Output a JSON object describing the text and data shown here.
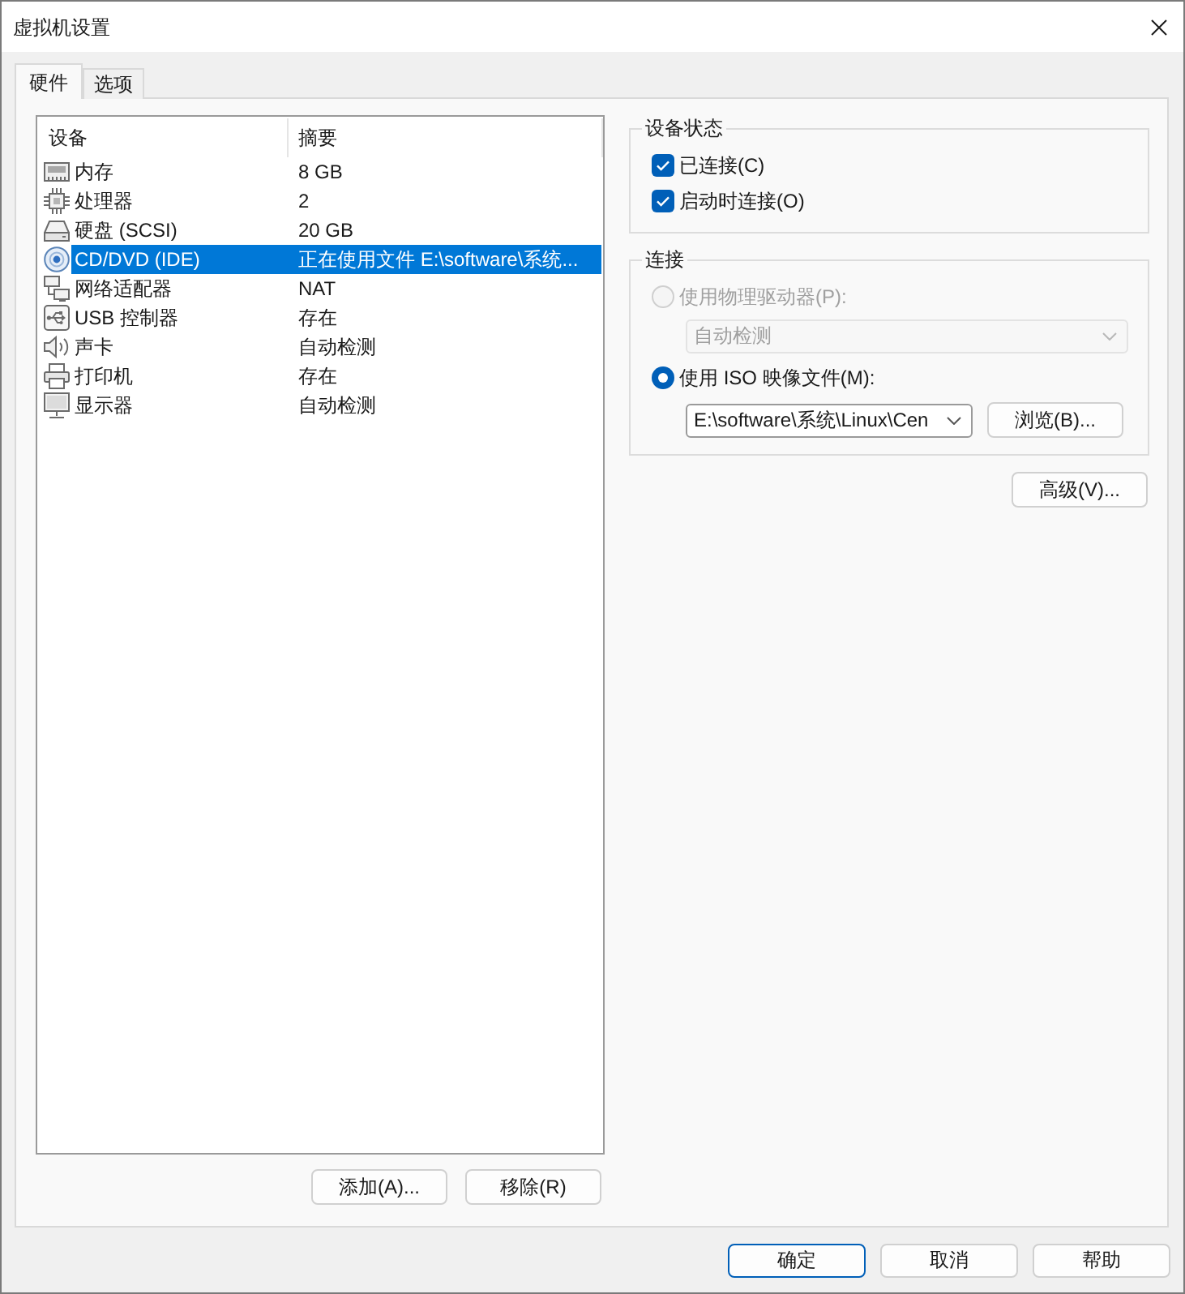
{
  "window": {
    "title": "虚拟机设置"
  },
  "tabs": [
    {
      "label": "硬件",
      "selected": true
    },
    {
      "label": "选项",
      "selected": false
    }
  ],
  "device_list": {
    "columns": [
      "设备",
      "摘要"
    ],
    "rows": [
      {
        "kind": "memory",
        "device": "内存",
        "summary": "8 GB",
        "selected": false
      },
      {
        "kind": "processor",
        "device": "处理器",
        "summary": "2",
        "selected": false
      },
      {
        "kind": "hard_disk",
        "device": "硬盘 (SCSI)",
        "summary": "20 GB",
        "selected": false
      },
      {
        "kind": "cd_dvd",
        "device": "CD/DVD (IDE)",
        "summary": "正在使用文件 E:\\software\\系统...",
        "selected": true
      },
      {
        "kind": "network",
        "device": "网络适配器",
        "summary": "NAT",
        "selected": false
      },
      {
        "kind": "usb",
        "device": "USB 控制器",
        "summary": "存在",
        "selected": false
      },
      {
        "kind": "sound",
        "device": "声卡",
        "summary": "自动检测",
        "selected": false
      },
      {
        "kind": "printer",
        "device": "打印机",
        "summary": "存在",
        "selected": false
      },
      {
        "kind": "display",
        "device": "显示器",
        "summary": "自动检测",
        "selected": false
      }
    ]
  },
  "list_buttons": [
    {
      "label": "添加(A)..."
    },
    {
      "label": "移除(R)"
    }
  ],
  "device_status": {
    "title": "设备状态",
    "options": [
      {
        "label": "已连接(C)",
        "checked": true
      },
      {
        "label": "启动时连接(O)",
        "checked": true
      }
    ]
  },
  "connection": {
    "title": "连接",
    "options": [
      {
        "kind": "physical_drive",
        "label": "使用物理驱动器(P):",
        "selected": false,
        "disabled": true,
        "dropdown": {
          "value": "自动检测",
          "disabled": true
        }
      },
      {
        "kind": "iso_image",
        "label": "使用 ISO 映像文件(M):",
        "selected": true,
        "disabled": false,
        "path": {
          "value": "E:\\software\\系统\\Linux\\Cen"
        },
        "browse_button": "浏览(B)..."
      }
    ]
  },
  "advanced_button": "高级(V)...",
  "dialog_buttons": [
    {
      "label": "确定",
      "default": true
    },
    {
      "label": "取消",
      "default": false
    },
    {
      "label": "帮助",
      "default": false
    }
  ]
}
